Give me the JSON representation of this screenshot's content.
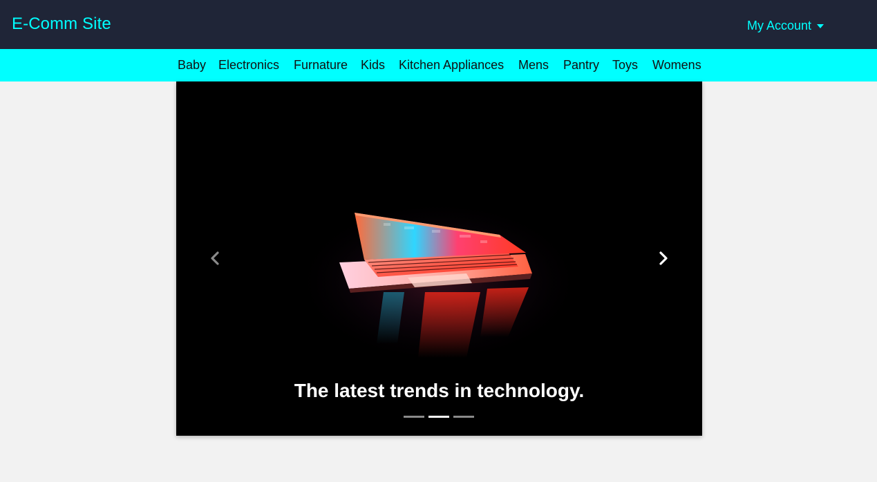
{
  "header": {
    "brand": "E-Comm Site",
    "account_label": "My Account",
    "background": "#1f2537",
    "accent": "#00ffff"
  },
  "categories": {
    "background": "#00ffff",
    "items": [
      {
        "label": "Baby"
      },
      {
        "label": "Electronics"
      },
      {
        "label": "Furnature"
      },
      {
        "label": "Kids"
      },
      {
        "label": "Kitchen Appliances"
      },
      {
        "label": "Mens"
      },
      {
        "label": "Pantry"
      },
      {
        "label": "Toys"
      },
      {
        "label": "Womens"
      }
    ]
  },
  "carousel": {
    "caption": "The latest trends in technology.",
    "prev_icon": "chevron-left-icon",
    "next_icon": "chevron-right-icon",
    "slide_count": 3,
    "active_index": 1
  }
}
